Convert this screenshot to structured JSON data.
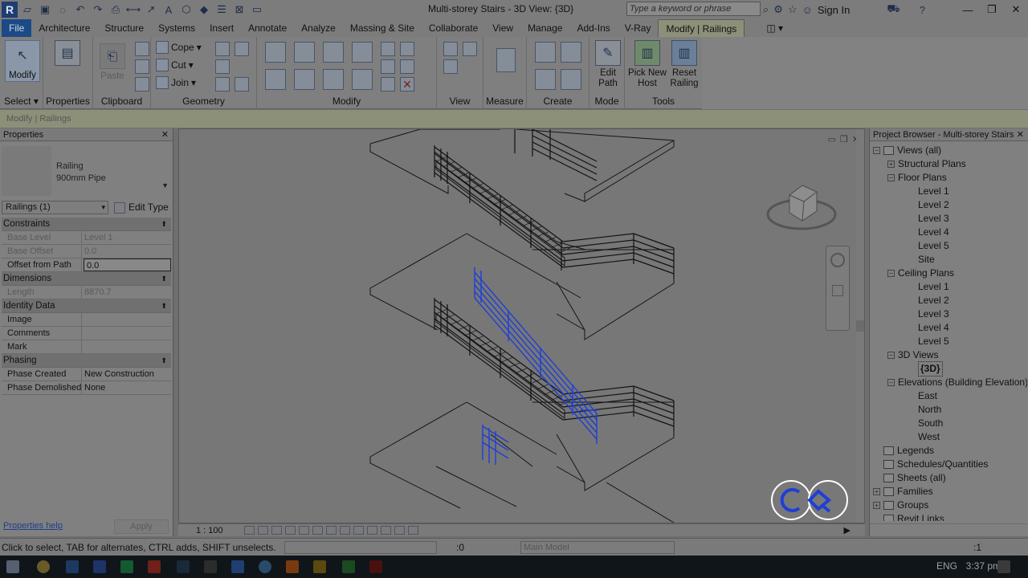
{
  "window": {
    "title": "Multi-storey Stairs - 3D View: {3D}",
    "search_placeholder": "Type a keyword or phrase",
    "sign_in": "Sign In"
  },
  "tabs": [
    "File",
    "Architecture",
    "Structure",
    "Systems",
    "Insert",
    "Annotate",
    "Analyze",
    "Massing & Site",
    "Collaborate",
    "View",
    "Manage",
    "Add-Ins",
    "V-Ray",
    "Modify | Railings"
  ],
  "ribbon": {
    "select": {
      "modify": "Modify",
      "label": "Select"
    },
    "properties": {
      "label": "Properties"
    },
    "clipboard": {
      "paste": "Paste",
      "label": "Clipboard"
    },
    "geometry": {
      "cope": "Cope",
      "cut": "Cut",
      "join": "Join",
      "label": "Geometry"
    },
    "modify_label": "Modify",
    "view_label": "View",
    "measure_label": "Measure",
    "create_label": "Create",
    "mode": {
      "edit_path": "Edit Path",
      "label": "Mode"
    },
    "tools": {
      "pick_new_host": "Pick New Host",
      "reset_railing": "Reset Railing",
      "label": "Tools"
    }
  },
  "context_bar": "Modify | Railings",
  "properties": {
    "title": "Properties",
    "type_family": "Railing",
    "type_name": "900mm Pipe",
    "filter": "Railings (1)",
    "edit_type": "Edit Type",
    "groups": [
      {
        "name": "Constraints",
        "rows": [
          {
            "k": "Base Level",
            "v": "Level 1",
            "dis": true
          },
          {
            "k": "Base Offset",
            "v": "0.0",
            "dis": true
          },
          {
            "k": "Offset from Path",
            "v": "0.0",
            "edit": true
          }
        ]
      },
      {
        "name": "Dimensions",
        "rows": [
          {
            "k": "Length",
            "v": "8870.7",
            "dis": true
          }
        ]
      },
      {
        "name": "Identity Data",
        "rows": [
          {
            "k": "Image",
            "v": ""
          },
          {
            "k": "Comments",
            "v": ""
          },
          {
            "k": "Mark",
            "v": ""
          }
        ]
      },
      {
        "name": "Phasing",
        "rows": [
          {
            "k": "Phase Created",
            "v": "New Construction"
          },
          {
            "k": "Phase Demolished",
            "v": "None"
          }
        ]
      }
    ],
    "help": "Properties help",
    "apply": "Apply"
  },
  "viewbar": {
    "scale": "1 : 100"
  },
  "browser": {
    "title": "Project Browser - Multi-storey Stairs",
    "nodes": [
      {
        "t": "Views (all)",
        "lvl": 0,
        "tg": "−",
        "ic": true
      },
      {
        "t": "Structural Plans",
        "lvl": 1,
        "tg": "+"
      },
      {
        "t": "Floor Plans",
        "lvl": 1,
        "tg": "−"
      },
      {
        "t": "Level 1",
        "lvl": 2
      },
      {
        "t": "Level 2",
        "lvl": 2
      },
      {
        "t": "Level 3",
        "lvl": 2
      },
      {
        "t": "Level 4",
        "lvl": 2
      },
      {
        "t": "Level 5",
        "lvl": 2
      },
      {
        "t": "Site",
        "lvl": 2
      },
      {
        "t": "Ceiling Plans",
        "lvl": 1,
        "tg": "−"
      },
      {
        "t": "Level 1",
        "lvl": 2
      },
      {
        "t": "Level 2",
        "lvl": 2
      },
      {
        "t": "Level 3",
        "lvl": 2
      },
      {
        "t": "Level 4",
        "lvl": 2
      },
      {
        "t": "Level 5",
        "lvl": 2
      },
      {
        "t": "3D Views",
        "lvl": 1,
        "tg": "−"
      },
      {
        "t": "{3D}",
        "lvl": 2,
        "sel": true
      },
      {
        "t": "Elevations (Building Elevation)",
        "lvl": 1,
        "tg": "−"
      },
      {
        "t": "East",
        "lvl": 2
      },
      {
        "t": "North",
        "lvl": 2
      },
      {
        "t": "South",
        "lvl": 2
      },
      {
        "t": "West",
        "lvl": 2
      },
      {
        "t": "Legends",
        "lvl": 0,
        "ic": true
      },
      {
        "t": "Schedules/Quantities",
        "lvl": 0,
        "ic": true
      },
      {
        "t": "Sheets (all)",
        "lvl": 0,
        "ic": true
      },
      {
        "t": "Families",
        "lvl": 0,
        "tg": "+",
        "ic": true
      },
      {
        "t": "Groups",
        "lvl": 0,
        "tg": "+",
        "ic": true
      },
      {
        "t": "Revit Links",
        "lvl": 0,
        "ic": true
      }
    ]
  },
  "status": {
    "hint": "Click to select, TAB for alternates, CTRL adds, SHIFT unselects.",
    "count": ":0",
    "workset": "Main Model",
    "filter_count": ":1"
  },
  "taskbar": {
    "lang": "ENG",
    "time": "3:37 pm"
  },
  "colors": {
    "accent": "#1b4a86",
    "selection": "#1e3fd6",
    "context_tab": "#8d9078"
  }
}
